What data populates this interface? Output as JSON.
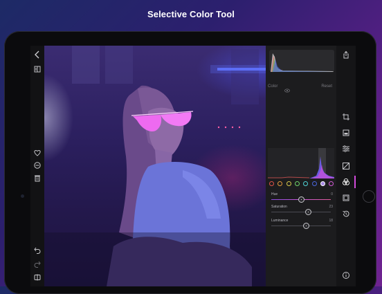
{
  "headline": "Selective Color Tool",
  "panel": {
    "color_label": "Color",
    "reset_label": "Reset",
    "swatches": [
      {
        "name": "red",
        "color": "#e0524a",
        "selected": false
      },
      {
        "name": "orange",
        "color": "#e39a3c",
        "selected": false
      },
      {
        "name": "yellow",
        "color": "#d8c94a",
        "selected": false
      },
      {
        "name": "green",
        "color": "#6fd36a",
        "selected": false
      },
      {
        "name": "aqua",
        "color": "#4fd4d8",
        "selected": false
      },
      {
        "name": "blue",
        "color": "#4a66e0",
        "selected": false
      },
      {
        "name": "purple",
        "color": "#a78ae6",
        "selected": true
      },
      {
        "name": "magenta",
        "color": "#d25bd6",
        "selected": false
      }
    ],
    "sliders": [
      {
        "name": "hue",
        "label": "Hue",
        "value": "0",
        "fraction": 0.5
      },
      {
        "name": "saturation",
        "label": "Saturation",
        "value": "23",
        "fraction": 0.62
      },
      {
        "name": "luminance",
        "label": "Luminance",
        "value": "18",
        "fraction": 0.59
      }
    ]
  },
  "icons": {
    "left": [
      "back-icon",
      "compare-icon",
      "heart-icon",
      "reject-icon",
      "trash-icon",
      "undo-icon",
      "redo-icon",
      "split-view-icon"
    ],
    "right": [
      "share-icon",
      "crop-icon",
      "preset-icon",
      "adjust-icon",
      "curves-icon",
      "selective-color-icon",
      "vignette-icon",
      "history-icon",
      "info-icon"
    ]
  },
  "accent_color": "#d34bdc"
}
